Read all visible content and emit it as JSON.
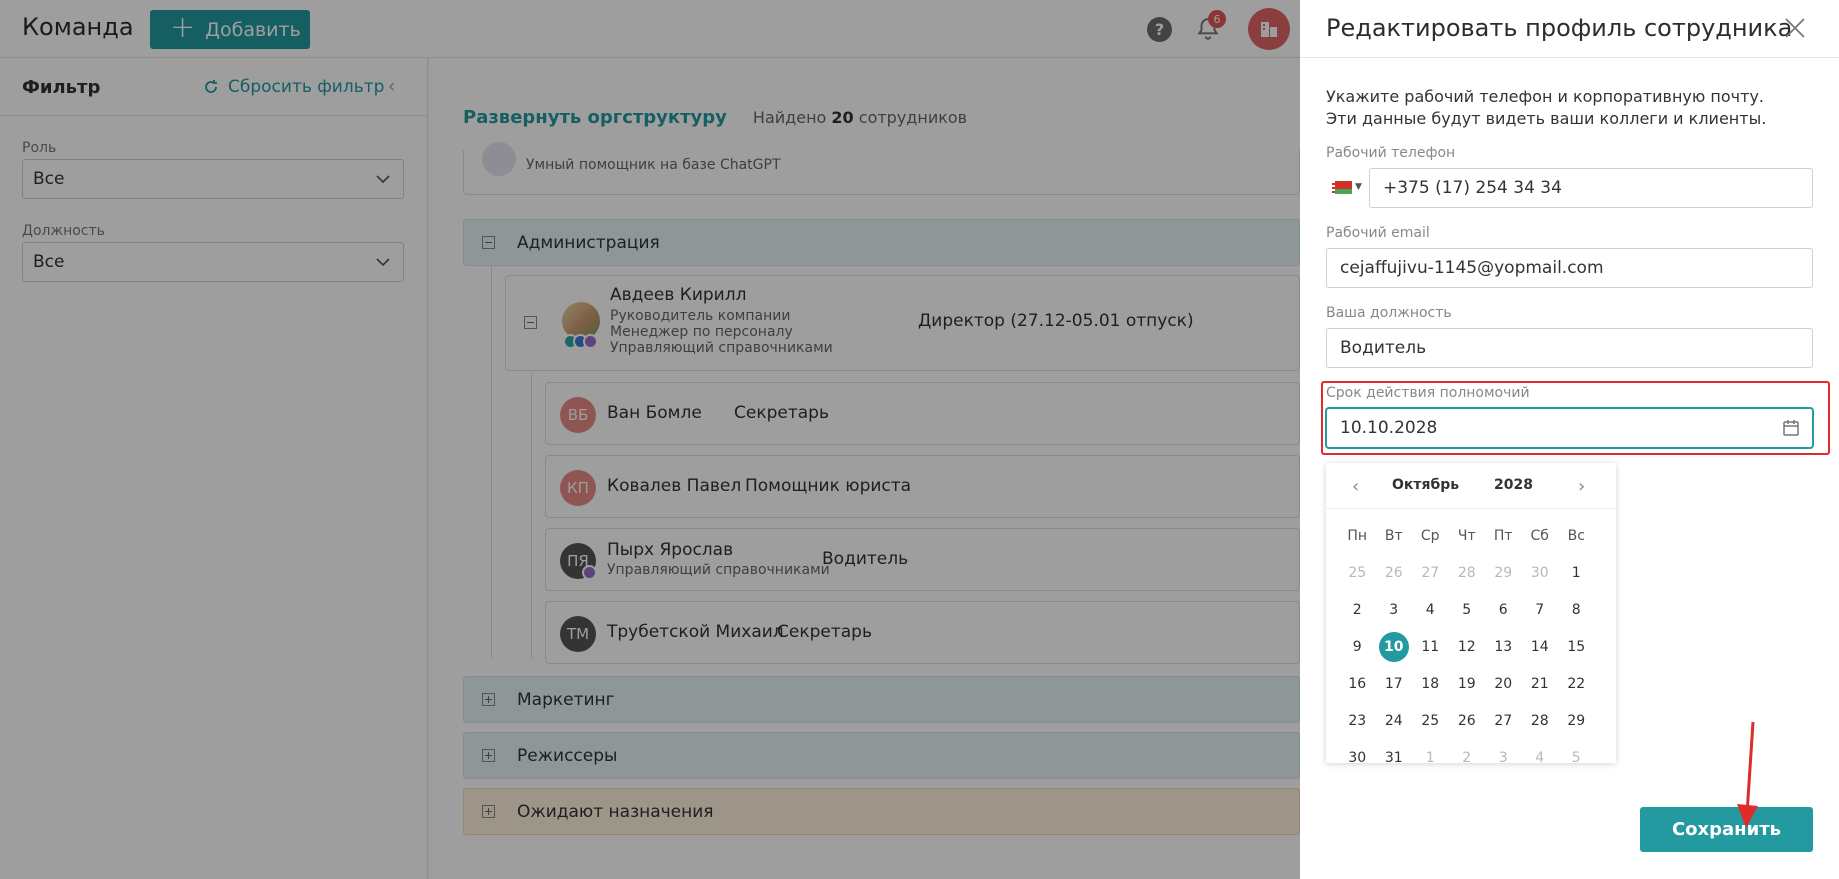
{
  "header": {
    "title": "Команда",
    "add_button": "Добавить",
    "help_icon": "?",
    "notification_count": "6"
  },
  "filter": {
    "title": "Фильтр",
    "reset": "Сбросить фильтр",
    "role_label": "Роль",
    "role_value": "Все",
    "position_label": "Должность",
    "position_value": "Все"
  },
  "main": {
    "expand_link": "Развернуть оргструктуру",
    "found_prefix": "Найдено",
    "found_count": "20",
    "found_suffix": "сотрудников",
    "assistant_text": "Умный помощник на базе ChatGPT",
    "departments": [
      {
        "name": "Администрация",
        "expanded": true
      },
      {
        "name": "Маркетинг",
        "expanded": false
      },
      {
        "name": "Режиссеры",
        "expanded": false
      },
      {
        "name": "Ожидают назначения",
        "expanded": false
      }
    ],
    "head": {
      "name": "Авдеев Кирилл",
      "roles": [
        "Руководитель компании",
        "Менеджер по персоналу",
        "Управляющий справочниками"
      ],
      "position": "Директор (27.12-05.01 отпуск)"
    },
    "employees": [
      {
        "initials": "ВБ",
        "name": "Ван Бомле",
        "position": "Секретарь",
        "subtitle": "",
        "color": "#e58a86"
      },
      {
        "initials": "КП",
        "name": "Ковалев Павел",
        "position": "Помощник юриста",
        "subtitle": "",
        "color": "#e58a86"
      },
      {
        "initials": "ПЯ",
        "name": "Пырх Ярослав",
        "position": "Водитель",
        "subtitle": "Управляющий справочниками",
        "color": "#555555"
      },
      {
        "initials": "ТМ",
        "name": "Трубетской Михаил",
        "position": "Секретарь",
        "subtitle": "",
        "color": "#555555"
      }
    ]
  },
  "panel": {
    "title": "Редактировать профиль сотрудника",
    "description": "Укажите рабочий телефон и корпоративную почту. Эти данные будут видеть ваши коллеги и клиенты.",
    "phone_label": "Рабочий телефон",
    "phone_value": "+375 (17) 254 34 34",
    "email_label": "Рабочий email",
    "email_value": "cejaffujivu-1145@yopmail.com",
    "position_label": "Ваша должность",
    "position_value": "Водитель",
    "term_label": "Срок действия полномочий",
    "term_value": "10.10.2028",
    "save_button": "Сохранить"
  },
  "calendar": {
    "month": "Октябрь",
    "year": "2028",
    "weekdays": [
      "Пн",
      "Вт",
      "Ср",
      "Чт",
      "Пт",
      "Сб",
      "Вс"
    ],
    "weeks": [
      [
        "25",
        "26",
        "27",
        "28",
        "29",
        "30",
        "1"
      ],
      [
        "2",
        "3",
        "4",
        "5",
        "6",
        "7",
        "8"
      ],
      [
        "9",
        "10",
        "11",
        "12",
        "13",
        "14",
        "15"
      ],
      [
        "16",
        "17",
        "18",
        "19",
        "20",
        "21",
        "22"
      ],
      [
        "23",
        "24",
        "25",
        "26",
        "27",
        "28",
        "29"
      ],
      [
        "30",
        "31",
        "1",
        "2",
        "3",
        "4",
        "5"
      ]
    ],
    "selected": "10"
  },
  "colors": {
    "accent": "#229aa0",
    "highlight": "#e02b2b",
    "badge": "#e05858"
  }
}
